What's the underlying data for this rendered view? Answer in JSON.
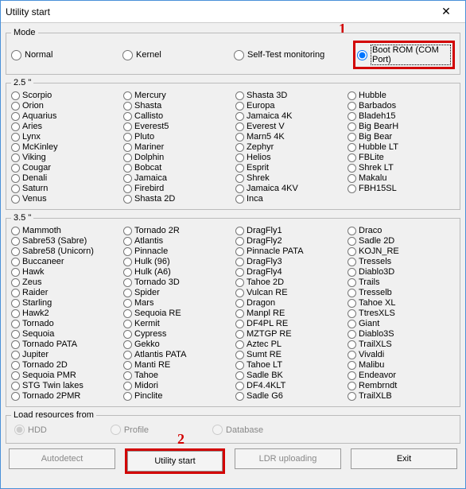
{
  "window": {
    "title": "Utility start",
    "close": "✕"
  },
  "annotations": {
    "one": "1",
    "two": "2"
  },
  "mode": {
    "legend": "Mode",
    "options": [
      "Normal",
      "Kernel",
      "Self-Test monitoring",
      "Boot ROM (COM Port)"
    ],
    "selected": 3
  },
  "group25legend": "2.5 \"",
  "group25": {
    "col1": [
      "Scorpio",
      "Orion",
      "Aquarius",
      "Aries",
      "Lynx",
      "McKinley",
      "Viking",
      "Cougar",
      "Denali",
      "Saturn",
      "Venus"
    ],
    "col2": [
      "Mercury",
      "Shasta",
      "Callisto",
      "Everest5",
      "Pluto",
      "Mariner",
      "Dolphin",
      "Bobcat",
      "Jamaica",
      "Firebird",
      "Shasta 2D"
    ],
    "col3": [
      "Shasta 3D",
      "Europa",
      "Jamaica 4K",
      "Everest V",
      "Marn5 4K",
      "Zephyr",
      "Helios",
      "Esprit",
      "Shrek",
      "Jamaica 4KV",
      "Inca"
    ],
    "col4": [
      "Hubble",
      "Barbados",
      "Bladeh15",
      "Big BearH",
      "Big Bear",
      "Hubble LT",
      "FBLite",
      "Shrek LT",
      "Makalu",
      "FBH15SL"
    ]
  },
  "group35legend": "3.5 \"",
  "group35": {
    "col1": [
      "Mammoth",
      "Sabre53 (Sabre)",
      "Sabre58 (Unicorn)",
      "Buccaneer",
      "Hawk",
      "Zeus",
      "Raider",
      "Starling",
      "Hawk2",
      "Tornado",
      "Sequoia",
      "Tornado PATA",
      "Jupiter",
      "Tornado 2D",
      "Sequoia PMR",
      "STG Twin lakes",
      "Tornado 2PMR"
    ],
    "col2": [
      "Tornado 2R",
      "Atlantis",
      "Pinnacle",
      "Hulk (96)",
      "Hulk (A6)",
      "Tornado 3D",
      "Spider",
      "Mars",
      "Sequoia RE",
      "Kermit",
      "Cypress",
      "Gekko",
      "Atlantis PATA",
      "Manti RE",
      "Tahoe",
      "Midori",
      "Pinclite"
    ],
    "col3": [
      "DragFly1",
      "DragFly2",
      "Pinnacle PATA",
      "DragFly3",
      "DragFly4",
      "Tahoe 2D",
      "Vulcan RE",
      "Dragon",
      "Manpl RE",
      "DF4PL RE",
      "MZTGP RE",
      "Aztec PL",
      "Sumt RE",
      "Tahoe LT",
      "Sadle BK",
      "DF4.4KLT",
      "Sadle G6"
    ],
    "col4": [
      "Draco",
      "Sadle 2D",
      "KOJN_RE",
      "Tressels",
      "Diablo3D",
      "Trails",
      "Tresselb",
      "Tahoe XL",
      "TtresXLS",
      "Giant",
      "Diablo3S",
      "TrailXLS",
      "Vivaldi",
      "Malibu",
      "Endeavor",
      "Rembrndt",
      "TrailXLB"
    ]
  },
  "load": {
    "legend": "Load resources from",
    "options": [
      "HDD",
      "Profile",
      "Database"
    ],
    "selected": 0
  },
  "buttons": {
    "autodetect": "Autodetect",
    "utility_start": "Utility start",
    "ldr_uploading": "LDR uploading",
    "exit": "Exit"
  }
}
